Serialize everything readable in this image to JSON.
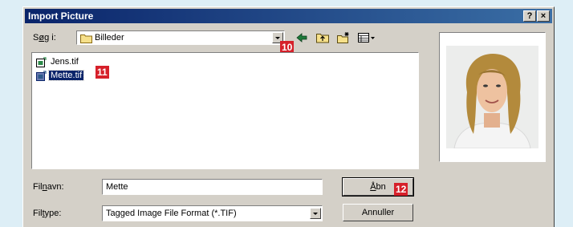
{
  "dialog": {
    "title": "Import Picture",
    "help_button": "?",
    "close_button": "×"
  },
  "lookin": {
    "label_pre": "S",
    "label_ul": "ø",
    "label_post": "g i:",
    "value": "Billeder"
  },
  "files": [
    {
      "name": "Jens.tif",
      "selected": false
    },
    {
      "name": "Mette.tif",
      "selected": true
    }
  ],
  "filename": {
    "label_pre": "Fil",
    "label_ul": "n",
    "label_post": "avn:",
    "value": "Mette"
  },
  "filetype": {
    "label_pre": "Fil",
    "label_ul": "t",
    "label_post": "ype:",
    "value": "Tagged Image File Format (*.TIF)"
  },
  "buttons": {
    "open_ul": "Å",
    "open_rest": "bn",
    "cancel": "Annuller"
  },
  "callouts": [
    "10",
    "11",
    "12"
  ],
  "colors": {
    "titlebar": "#0a246a",
    "selection": "#0a246a",
    "callout": "#d6202a",
    "dialog_face": "#d4d0c8",
    "page_background": "#ddeef6"
  },
  "icons": [
    "folder-icon",
    "back-arrow-icon",
    "up-folder-icon",
    "new-folder-icon",
    "view-menu-icon",
    "tif-file-icon"
  ]
}
